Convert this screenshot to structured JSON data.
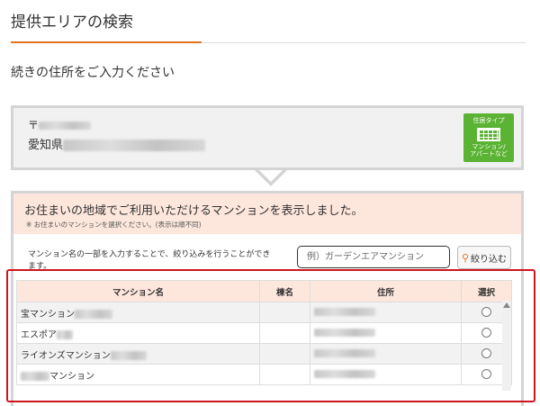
{
  "page": {
    "title": "提供エリアの検索",
    "subtitle": "続きの住所をご入力ください"
  },
  "address": {
    "zip_prefix": "〒",
    "prefecture": "愛知県"
  },
  "badge": {
    "label_top": "住居タイプ",
    "icon": "building-icon",
    "label_bottom_1": "マンション/",
    "label_bottom_2": "アパートなど",
    "color": "#5ab332"
  },
  "notice": {
    "main": "お住まいの地域でご利用いただけるマンションを表示しました。",
    "sub": "※ お住まいのマンションを選択ください。(表示は順不同)"
  },
  "filter": {
    "description": "マンション名の一部を入力することで、絞り込みを行うことができます。",
    "placeholder": "例）ガーデンエアマンション",
    "button_label": "絞り込む",
    "button_icon": "search-icon"
  },
  "table": {
    "headers": [
      "マンション名",
      "棟名",
      "住所",
      "選択"
    ],
    "rows": [
      {
        "name_prefix": "宝マンション",
        "name_suffix": "",
        "building": ""
      },
      {
        "name_prefix": "エスポア",
        "name_suffix": "",
        "building": ""
      },
      {
        "name_prefix": "ライオンズマンション",
        "name_suffix": "",
        "building": ""
      },
      {
        "name_prefix": "",
        "name_suffix": "マンション",
        "building": ""
      }
    ]
  },
  "colors": {
    "accent": "#e2731f",
    "notice_bg": "#fde6dc",
    "highlight": "#d0141e"
  }
}
